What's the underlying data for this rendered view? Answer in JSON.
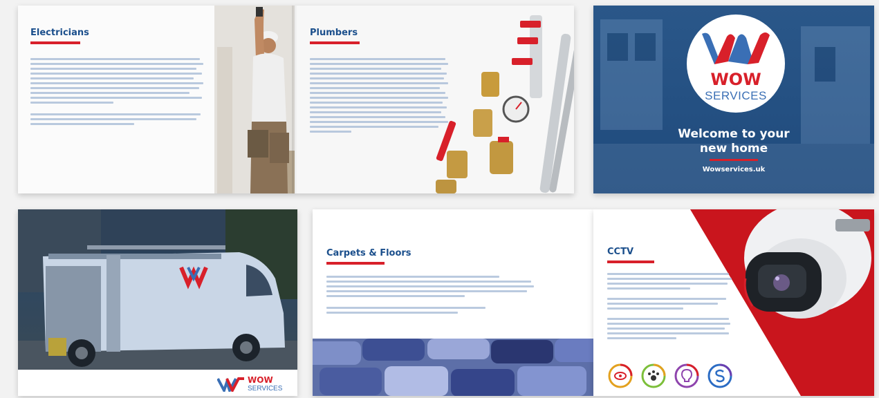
{
  "brochure_spread": {
    "electricians": {
      "title": "Electricians"
    },
    "plumbers": {
      "title": "Plumbers"
    }
  },
  "cover": {
    "logo": {
      "wordmark": "WOW",
      "submark": "SERVICES"
    },
    "welcome": "Welcome to your new home",
    "url": "Wowservices.uk"
  },
  "van_page": {
    "logo": {
      "wordmark": "WOW",
      "submark": "SERVICES"
    }
  },
  "carpets_page": {
    "title": "Carpets & Floors"
  },
  "cctv_page": {
    "title": "CCTV"
  },
  "colors": {
    "brand_blue": "#1b4f8c",
    "brand_red": "#d8202a",
    "cover_blue": "#2a5789"
  },
  "icons": [
    "camera-eye-icon",
    "paw-icon",
    "bulb-icon",
    "coin-icon"
  ]
}
